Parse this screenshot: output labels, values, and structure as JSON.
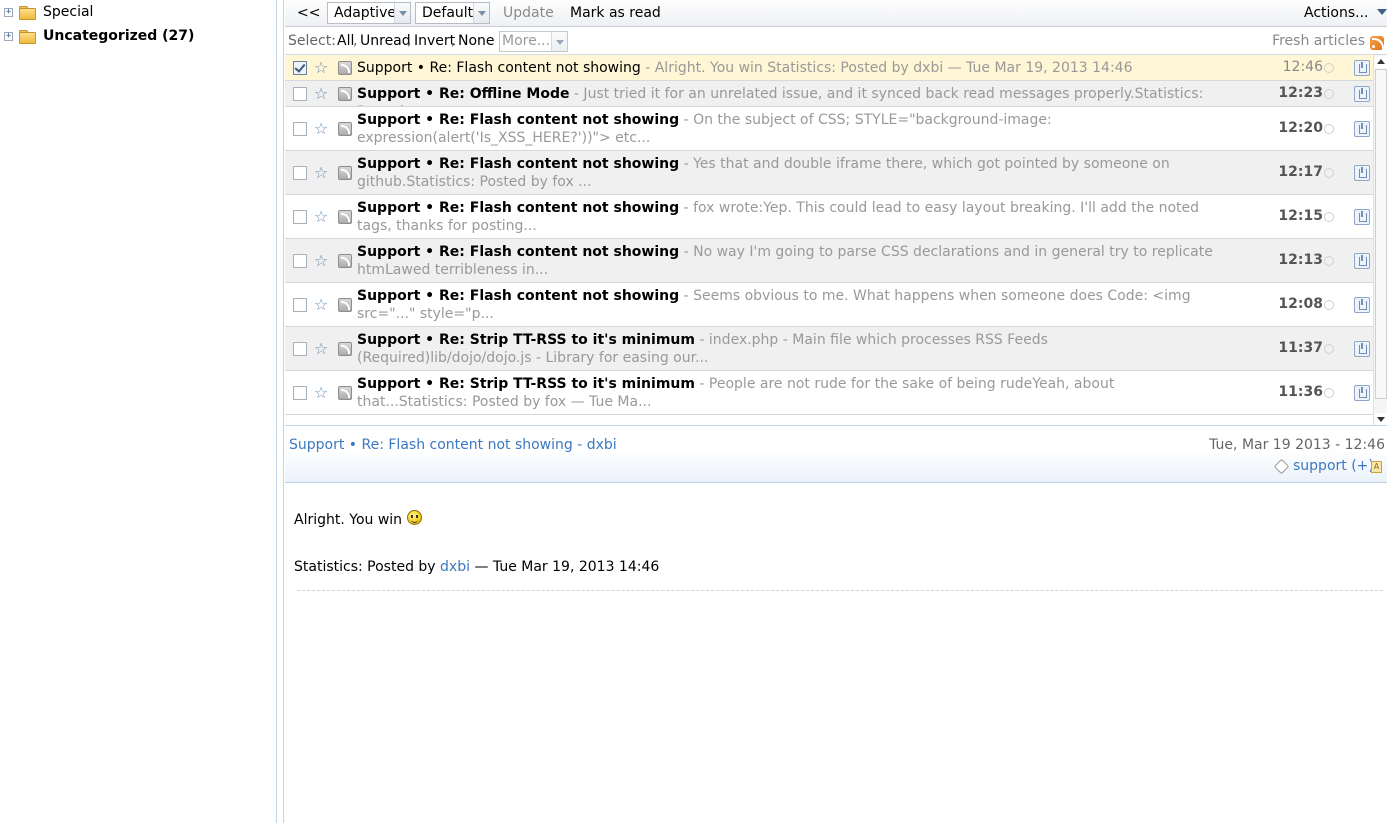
{
  "sidebar": {
    "items": [
      {
        "label": "Special",
        "expand": "+"
      },
      {
        "label": "Uncategorized (27)",
        "expand": "+"
      }
    ]
  },
  "toolbar": {
    "back_label": "<<",
    "view_mode": "Adaptive",
    "order": "Default",
    "update_label": "Update",
    "mark_read_label": "Mark as read",
    "actions_label": "Actions..."
  },
  "selectbar": {
    "prefix": "Select:",
    "all": "All",
    "unread": "Unread",
    "invert": "Invert",
    "none": "None",
    "sep": ",",
    "more_placeholder": "More...",
    "feed_title": "Fresh articles"
  },
  "headlines": [
    {
      "title": "Support • Re: Flash content not showing",
      "excerpt": " - Alright. You win Statistics: Posted by dxbi — Tue Mar 19, 2013 14:46",
      "time": "12:46",
      "checked": true,
      "unread": false
    },
    {
      "title": "Support • Re: Offline Mode",
      "excerpt": " - Just tried it for an unrelated issue, and it synced back read messages properly.Statistics: Posted ...",
      "time": "12:23",
      "checked": false,
      "unread": true
    },
    {
      "title": "Support • Re: Flash content not showing",
      "excerpt": " - On the subject of CSS; STYLE=\"background-image: expression(alert('Is_XSS_HERE?'))\"> etc...",
      "time": "12:20",
      "checked": false,
      "unread": true
    },
    {
      "title": "Support • Re: Flash content not showing",
      "excerpt": " - Yes that and double iframe there, which got pointed by someone on github.Statistics: Posted by fox ...",
      "time": "12:17",
      "checked": false,
      "unread": true
    },
    {
      "title": "Support • Re: Flash content not showing",
      "excerpt": " - fox wrote:Yep. This could lead to easy layout breaking. I'll add the noted tags, thanks for posting...",
      "time": "12:15",
      "checked": false,
      "unread": true
    },
    {
      "title": "Support • Re: Flash content not showing",
      "excerpt": " - No way I'm going to parse CSS declarations and in general try to replicate htmLawed terribleness in...",
      "time": "12:13",
      "checked": false,
      "unread": true
    },
    {
      "title": "Support • Re: Flash content not showing",
      "excerpt": " - Seems obvious to me. What happens when someone does Code: <img src=\"...\" style=\"p...",
      "time": "12:08",
      "checked": false,
      "unread": true
    },
    {
      "title": "Support • Re: Strip TT-RSS to it's minimum",
      "excerpt": " - index.php - Main file which processes RSS Feeds (Required)lib/dojo/dojo.js - Library for easing our...",
      "time": "11:37",
      "checked": false,
      "unread": true
    },
    {
      "title": "Support • Re: Strip TT-RSS to it's minimum",
      "excerpt": " - People are not rude for the sake of being rudeYeah, about that...Statistics: Posted by fox — Tue Ma...",
      "time": "11:36",
      "checked": false,
      "unread": true
    }
  ],
  "article": {
    "title": "Support • Re: Flash content not showing - dxbi",
    "date": "Tue, Mar 19 2013 - 12:46",
    "tags": "support (+)",
    "note_icon": "A",
    "body_text": "Alright. You win",
    "stats_prefix": "Statistics: Posted by",
    "stats_author": "dxbi",
    "stats_suffix": "— Tue Mar 19, 2013 14:46"
  },
  "colors": {
    "link": "#3b78c0",
    "active_row": "#fff6d5",
    "odd_row": "#f0f0f0"
  }
}
